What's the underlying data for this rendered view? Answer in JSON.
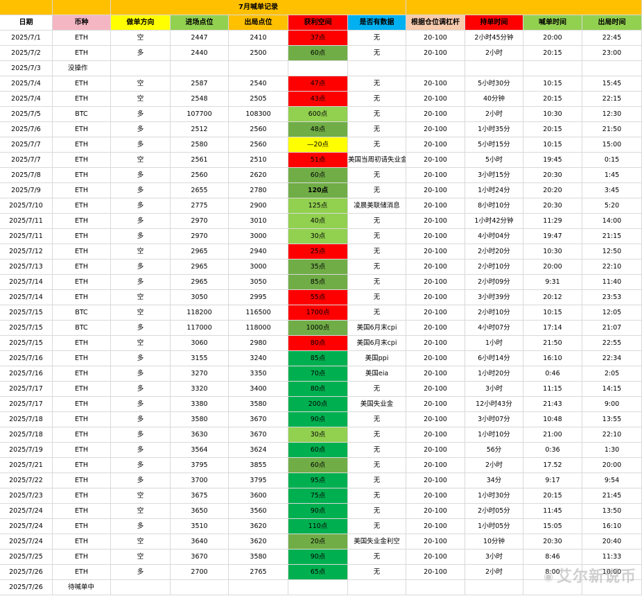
{
  "sheet_title": "7月喊单记录",
  "colors": {
    "title_bg": "#ffc000",
    "hdr_date": "#ffffff",
    "hdr_coin": "#f4b6c2",
    "hdr_dir": "#ffff00",
    "hdr_entry": "#92d050",
    "hdr_exit": "#ffc000",
    "hdr_profit": "#ff0000",
    "hdr_data": "#00b0f0",
    "hdr_lev": "#f8cbad",
    "hdr_hold": "#ff0000",
    "hdr_call": "#92d050",
    "hdr_out": "#92d050",
    "red": "#ff0000",
    "yellow": "#ffff00",
    "green_dark": "#00b050",
    "green_mid": "#70ad47",
    "green_light": "#92d050"
  },
  "headers": [
    "日期",
    "币种",
    "做单方向",
    "进场点位",
    "出局点位",
    "获利空间",
    "是否有数据",
    "根据仓位调杠杆",
    "持单时间",
    "喊单时间",
    "出局时间"
  ],
  "rows": [
    {
      "date": "2025/7/1",
      "coin": "ETH",
      "dir": "空",
      "entry": "2447",
      "exit": "2410",
      "profit": "37点",
      "pc": "red",
      "data": "无",
      "lev": "20-100",
      "hold": "2小时45分钟",
      "call": "20:00",
      "out": "22:45"
    },
    {
      "date": "2025/7/2",
      "coin": "ETH",
      "dir": "多",
      "entry": "2440",
      "exit": "2500",
      "profit": "60点",
      "pc": "green_mid",
      "data": "无",
      "lev": "20-100",
      "hold": "2小时",
      "call": "20:15",
      "out": "23:00"
    },
    {
      "date": "2025/7/3",
      "coin": "没操作",
      "dir": "",
      "entry": "",
      "exit": "",
      "profit": "",
      "pc": "",
      "data": "",
      "lev": "",
      "hold": "",
      "call": "",
      "out": "",
      "note": true
    },
    {
      "date": "2025/7/4",
      "coin": "ETH",
      "dir": "空",
      "entry": "2587",
      "exit": "2540",
      "profit": "47点",
      "pc": "red",
      "data": "无",
      "lev": "20-100",
      "hold": "5小时30分",
      "call": "10:15",
      "out": "15:45"
    },
    {
      "date": "2025/7/4",
      "coin": "ETH",
      "dir": "空",
      "entry": "2548",
      "exit": "2505",
      "profit": "43点",
      "pc": "red",
      "data": "无",
      "lev": "20-100",
      "hold": "40分钟",
      "call": "20:15",
      "out": "22:15"
    },
    {
      "date": "2025/7/5",
      "coin": "BTC",
      "dir": "多",
      "entry": "107700",
      "exit": "108300",
      "profit": "600点",
      "pc": "green_light",
      "data": "无",
      "lev": "20-100",
      "hold": "2小时",
      "call": "10:30",
      "out": "12:30"
    },
    {
      "date": "2025/7/6",
      "coin": "ETH",
      "dir": "多",
      "entry": "2512",
      "exit": "2560",
      "profit": "48点",
      "pc": "green_mid",
      "data": "无",
      "lev": "20-100",
      "hold": "1小时35分",
      "call": "20:15",
      "out": "21:50"
    },
    {
      "date": "2025/7/7",
      "coin": "ETH",
      "dir": "多",
      "entry": "2580",
      "exit": "2560",
      "profit": "—20点",
      "pc": "yellow",
      "data": "无",
      "lev": "20-100",
      "hold": "5小时15分",
      "call": "10:15",
      "out": "15:00"
    },
    {
      "date": "2025/7/7",
      "coin": "ETH",
      "dir": "空",
      "entry": "2561",
      "exit": "2510",
      "profit": "51点",
      "pc": "red",
      "data": "美国当周初请失业金",
      "lev": "20-100",
      "hold": "5小时",
      "call": "19:45",
      "out": "0:15"
    },
    {
      "date": "2025/7/8",
      "coin": "ETH",
      "dir": "多",
      "entry": "2560",
      "exit": "2620",
      "profit": "60点",
      "pc": "green_mid",
      "data": "无",
      "lev": "20-100",
      "hold": "3小时15分",
      "call": "20:30",
      "out": "1:45"
    },
    {
      "date": "2025/7/9",
      "coin": "ETH",
      "dir": "多",
      "entry": "2655",
      "exit": "2780",
      "profit": "120点",
      "pc": "green_mid",
      "data": "无",
      "lev": "20-100",
      "hold": "1小时24分",
      "call": "20:20",
      "out": "3:45",
      "bold": true
    },
    {
      "date": "2025/7/10",
      "coin": "ETH",
      "dir": "多",
      "entry": "2775",
      "exit": "2900",
      "profit": "125点",
      "pc": "green_light",
      "data": "凌晨美联储消息",
      "lev": "20-100",
      "hold": "8小时10分",
      "call": "20:30",
      "out": "5:20"
    },
    {
      "date": "2025/7/11",
      "coin": "ETH",
      "dir": "多",
      "entry": "2970",
      "exit": "3010",
      "profit": "40点",
      "pc": "green_light",
      "data": "无",
      "lev": "20-100",
      "hold": "1小时42分钟",
      "call": "11:29",
      "out": "14:00"
    },
    {
      "date": "2025/7/11",
      "coin": "ETH",
      "dir": "多",
      "entry": "2970",
      "exit": "3000",
      "profit": "30点",
      "pc": "green_light",
      "data": "无",
      "lev": "20-100",
      "hold": "4小时04分",
      "call": "19:47",
      "out": "21:15"
    },
    {
      "date": "2025/7/12",
      "coin": "ETH",
      "dir": "空",
      "entry": "2965",
      "exit": "2940",
      "profit": "25点",
      "pc": "red",
      "data": "无",
      "lev": "20-100",
      "hold": "2小时20分",
      "call": "10:30",
      "out": "12:50"
    },
    {
      "date": "2025/7/13",
      "coin": "ETH",
      "dir": "多",
      "entry": "2965",
      "exit": "3000",
      "profit": "35点",
      "pc": "green_mid",
      "data": "无",
      "lev": "20-100",
      "hold": "2小时10分",
      "call": "20:00",
      "out": "22:10"
    },
    {
      "date": "2025/7/14",
      "coin": "ETH",
      "dir": "多",
      "entry": "2965",
      "exit": "3050",
      "profit": "85点",
      "pc": "green_mid",
      "data": "无",
      "lev": "20-100",
      "hold": "2小时09分",
      "call": "9:31",
      "out": "11:40"
    },
    {
      "date": "2025/7/14",
      "coin": "ETH",
      "dir": "空",
      "entry": "3050",
      "exit": "2995",
      "profit": "55点",
      "pc": "red",
      "data": "无",
      "lev": "20-100",
      "hold": "3小时39分",
      "call": "20:12",
      "out": "23:53"
    },
    {
      "date": "2025/7/15",
      "coin": "BTC",
      "dir": "空",
      "entry": "118200",
      "exit": "116500",
      "profit": "1700点",
      "pc": "red",
      "data": "无",
      "lev": "20-100",
      "hold": "2小时10分",
      "call": "10:15",
      "out": "12:05"
    },
    {
      "date": "2025/7/15",
      "coin": "BTC",
      "dir": "多",
      "entry": "117000",
      "exit": "118000",
      "profit": "1000点",
      "pc": "green_mid",
      "data": "美国6月末cpi",
      "lev": "20-100",
      "hold": "4小时07分",
      "call": "17:14",
      "out": "21:07"
    },
    {
      "date": "2025/7/15",
      "coin": "ETH",
      "dir": "空",
      "entry": "3060",
      "exit": "2980",
      "profit": "80点",
      "pc": "red",
      "data": "美国6月末cpi",
      "lev": "20-100",
      "hold": "1小时",
      "call": "21:50",
      "out": "22:55"
    },
    {
      "date": "2025/7/16",
      "coin": "ETH",
      "dir": "多",
      "entry": "3155",
      "exit": "3240",
      "profit": "85点",
      "pc": "green_dark",
      "data": "美国ppi",
      "lev": "20-100",
      "hold": "6小时14分",
      "call": "16:10",
      "out": "22:34"
    },
    {
      "date": "2025/7/16",
      "coin": "ETH",
      "dir": "多",
      "entry": "3270",
      "exit": "3350",
      "profit": "70点",
      "pc": "green_dark",
      "data": "美国eia",
      "lev": "20-100",
      "hold": "1小时20分",
      "call": "0:46",
      "out": "2:05"
    },
    {
      "date": "2025/7/17",
      "coin": "ETH",
      "dir": "多",
      "entry": "3320",
      "exit": "3400",
      "profit": "80点",
      "pc": "green_dark",
      "data": "无",
      "lev": "20-100",
      "hold": "3小时",
      "call": "11:15",
      "out": "14:15"
    },
    {
      "date": "2025/7/17",
      "coin": "ETH",
      "dir": "多",
      "entry": "3380",
      "exit": "3580",
      "profit": "200点",
      "pc": "green_dark",
      "data": "美国失业金",
      "lev": "20-100",
      "hold": "12小时43分",
      "call": "21:43",
      "out": "9:00"
    },
    {
      "date": "2025/7/18",
      "coin": "ETH",
      "dir": "多",
      "entry": "3580",
      "exit": "3670",
      "profit": "90点",
      "pc": "green_dark",
      "data": "无",
      "lev": "20-100",
      "hold": "3小时07分",
      "call": "10:48",
      "out": "13:55"
    },
    {
      "date": "2025/7/18",
      "coin": "ETH",
      "dir": "多",
      "entry": "3630",
      "exit": "3670",
      "profit": "30点",
      "pc": "green_light",
      "data": "无",
      "lev": "20-100",
      "hold": "1小时10分",
      "call": "21:00",
      "out": "22:10"
    },
    {
      "date": "2025/7/19",
      "coin": "ETH",
      "dir": "多",
      "entry": "3564",
      "exit": "3624",
      "profit": "60点",
      "pc": "green_dark",
      "data": "无",
      "lev": "20-100",
      "hold": "56分",
      "call": "0:36",
      "out": "1:30"
    },
    {
      "date": "2025/7/21",
      "coin": "ETH",
      "dir": "多",
      "entry": "3795",
      "exit": "3855",
      "profit": "60点",
      "pc": "green_mid",
      "data": "无",
      "lev": "20-100",
      "hold": "2小时",
      "call": "17.52",
      "out": "20:00"
    },
    {
      "date": "2025/7/22",
      "coin": "ETH",
      "dir": "多",
      "entry": "3700",
      "exit": "3795",
      "profit": "95点",
      "pc": "green_dark",
      "data": "无",
      "lev": "20-100",
      "hold": "34分",
      "call": "9:17",
      "out": "9:54"
    },
    {
      "date": "2025/7/23",
      "coin": "ETH",
      "dir": "空",
      "entry": "3675",
      "exit": "3600",
      "profit": "75点",
      "pc": "green_dark",
      "data": "无",
      "lev": "20-100",
      "hold": "1小时30分",
      "call": "20:15",
      "out": "21:45"
    },
    {
      "date": "2025/7/24",
      "coin": "ETH",
      "dir": "空",
      "entry": "3650",
      "exit": "3560",
      "profit": "90点",
      "pc": "green_dark",
      "data": "无",
      "lev": "20-100",
      "hold": "2小时05分",
      "call": "11:45",
      "out": "13:50"
    },
    {
      "date": "2025/7/24",
      "coin": "ETH",
      "dir": "多",
      "entry": "3510",
      "exit": "3620",
      "profit": "110点",
      "pc": "green_dark",
      "data": "无",
      "lev": "20-100",
      "hold": "1小时05分",
      "call": "15:05",
      "out": "16:10"
    },
    {
      "date": "2025/7/24",
      "coin": "ETH",
      "dir": "空",
      "entry": "3640",
      "exit": "3620",
      "profit": "20点",
      "pc": "green_mid",
      "data": "美国失业金利空",
      "lev": "20-100",
      "hold": "10分钟",
      "call": "20:30",
      "out": "20:40"
    },
    {
      "date": "2025/7/25",
      "coin": "ETH",
      "dir": "空",
      "entry": "3670",
      "exit": "3580",
      "profit": "90点",
      "pc": "green_dark",
      "data": "无",
      "lev": "20-100",
      "hold": "3小时",
      "call": "8:46",
      "out": "11:33"
    },
    {
      "date": "2025/7/26",
      "coin": "ETH",
      "dir": "多",
      "entry": "2700",
      "exit": "2765",
      "profit": "65点",
      "pc": "green_dark",
      "data": "无",
      "lev": "20-100",
      "hold": "2小时",
      "call": "8:00",
      "out": "10:00"
    },
    {
      "date": "2025/7/26",
      "coin": "待喊单中",
      "dir": "",
      "entry": "",
      "exit": "",
      "profit": "",
      "pc": "",
      "data": "",
      "lev": "",
      "hold": "",
      "call": "",
      "out": "",
      "note": true
    }
  ],
  "watermark": {
    "text": "艾尔新说币",
    "icon": "weibo-icon"
  }
}
